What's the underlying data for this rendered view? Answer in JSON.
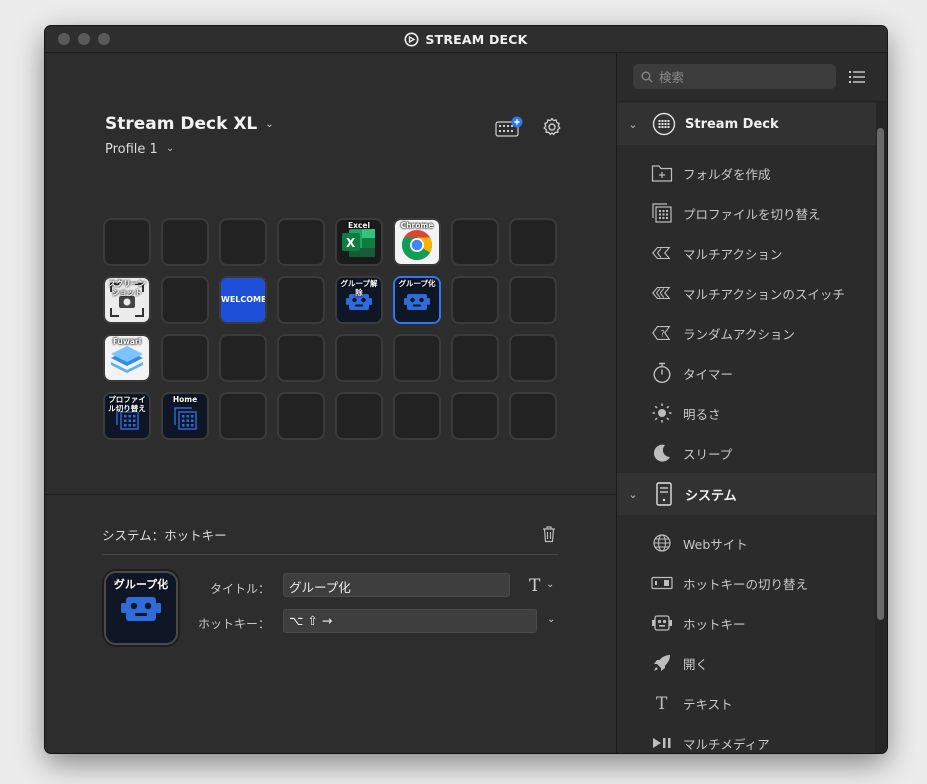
{
  "window": {
    "title": "STREAM DECK"
  },
  "device": {
    "name": "Stream Deck XL",
    "profile": "Profile 1"
  },
  "keys": [
    {
      "label": "",
      "type": "empty"
    },
    {
      "label": "",
      "type": "empty"
    },
    {
      "label": "",
      "type": "empty"
    },
    {
      "label": "",
      "type": "empty"
    },
    {
      "label": "Excel",
      "type": "excel"
    },
    {
      "label": "Chrome",
      "type": "chrome"
    },
    {
      "label": "",
      "type": "empty"
    },
    {
      "label": "",
      "type": "empty"
    },
    {
      "label": "スクリーンショット",
      "type": "screenshot"
    },
    {
      "label": "",
      "type": "empty"
    },
    {
      "label": "WELCOME",
      "type": "welcome"
    },
    {
      "label": "",
      "type": "empty"
    },
    {
      "label": "グループ解除",
      "type": "robot"
    },
    {
      "label": "グループ化",
      "type": "robot-selected"
    },
    {
      "label": "",
      "type": "empty"
    },
    {
      "label": "",
      "type": "empty"
    },
    {
      "label": "Fuwari",
      "type": "fuwari"
    },
    {
      "label": "",
      "type": "empty"
    },
    {
      "label": "",
      "type": "empty"
    },
    {
      "label": "",
      "type": "empty"
    },
    {
      "label": "",
      "type": "empty"
    },
    {
      "label": "",
      "type": "empty"
    },
    {
      "label": "",
      "type": "empty"
    },
    {
      "label": "",
      "type": "empty"
    },
    {
      "label": "プロファイル切り替え",
      "type": "profile"
    },
    {
      "label": "Home",
      "type": "profile"
    },
    {
      "label": "",
      "type": "empty"
    },
    {
      "label": "",
      "type": "empty"
    },
    {
      "label": "",
      "type": "empty"
    },
    {
      "label": "",
      "type": "empty"
    },
    {
      "label": "",
      "type": "empty"
    },
    {
      "label": "",
      "type": "empty"
    }
  ],
  "properties": {
    "heading": "システム：ホットキー",
    "preview_label": "グループ化",
    "title_label": "タイトル：",
    "title_value": "グループ化",
    "hotkey_label": "ホットキー：",
    "hotkey_value": "⌥ ⇧ →"
  },
  "sidebar": {
    "search_placeholder": "検索",
    "categories": [
      {
        "label": "Stream Deck",
        "icon": "stream-deck-icon",
        "items": [
          {
            "label": "フォルダを作成",
            "icon": "folder-icon"
          },
          {
            "label": "プロファイルを切り替え",
            "icon": "profile-switch-icon"
          },
          {
            "label": "マルチアクション",
            "icon": "multi-action-icon"
          },
          {
            "label": "マルチアクションのスイッチ",
            "icon": "multi-action-switch-icon"
          },
          {
            "label": "ランダムアクション",
            "icon": "random-action-icon"
          },
          {
            "label": "タイマー",
            "icon": "timer-icon"
          },
          {
            "label": "明るさ",
            "icon": "brightness-icon"
          },
          {
            "label": "スリープ",
            "icon": "sleep-icon"
          }
        ]
      },
      {
        "label": "システム",
        "icon": "system-icon",
        "items": [
          {
            "label": "Webサイト",
            "icon": "globe-icon"
          },
          {
            "label": "ホットキーの切り替え",
            "icon": "hotkey-switch-icon"
          },
          {
            "label": "ホットキー",
            "icon": "hotkey-icon"
          },
          {
            "label": "開く",
            "icon": "rocket-icon"
          },
          {
            "label": "テキスト",
            "icon": "text-icon"
          },
          {
            "label": "マルチメディア",
            "icon": "multimedia-icon"
          }
        ]
      }
    ]
  },
  "colors": {
    "accent": "#2c79f0",
    "welcome_bg": "#1d4fd8",
    "window_bg": "#2d2d2d"
  }
}
